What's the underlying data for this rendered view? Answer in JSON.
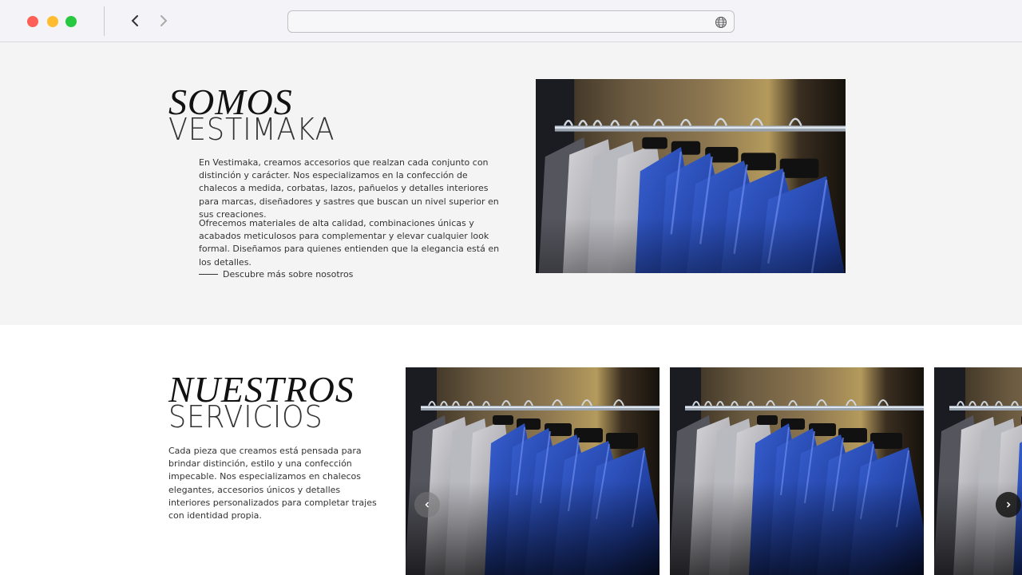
{
  "browser": {
    "back_icon": "chevron-left-icon",
    "forward_icon": "chevron-right-icon",
    "address_placeholder": "",
    "globe_icon": "globe-icon"
  },
  "about": {
    "title_italic": "SOMOS",
    "title_light": "VESTIMAKA",
    "paragraph_1": "En Vestimaka, creamos accesorios que realzan cada conjunto con distinción y carácter. Nos especializamos en la confección de chalecos a medida, corbatas, lazos, pañuelos y detalles interiores para marcas, diseñadores y sastres que buscan un nivel superior en sus creaciones.",
    "paragraph_2": "Ofrecemos materiales de alta calidad, combinaciones únicas y acabados meticulosos para complementar y elevar cualquier look formal. Diseñamos para quienes entienden que la elegancia está en los detalles.",
    "link_label": "Descubre más sobre nosotros",
    "image_icon": "suits-on-rack-photo"
  },
  "services": {
    "title_italic": "NUESTROS",
    "title_light": "SERVICIOS",
    "paragraph": "Cada pieza que creamos está pensada para brindar distinción, estilo y una confección impecable. Nos especializamos en chalecos elegantes, accesorios únicos y detalles interiores personalizados para completar trajes con identidad propia.",
    "cards": [
      {
        "image_icon": "suits-on-rack-photo"
      },
      {
        "image_icon": "suits-on-rack-photo"
      },
      {
        "image_icon": "suits-on-rack-photo"
      }
    ],
    "prev_icon": "chevron-left-icon",
    "next_icon": "chevron-right-icon"
  },
  "colors": {
    "about_bg": "#f4f4f4",
    "suit_blue": "#2a4fb8",
    "chrome_bg": "#f4f4f8"
  }
}
